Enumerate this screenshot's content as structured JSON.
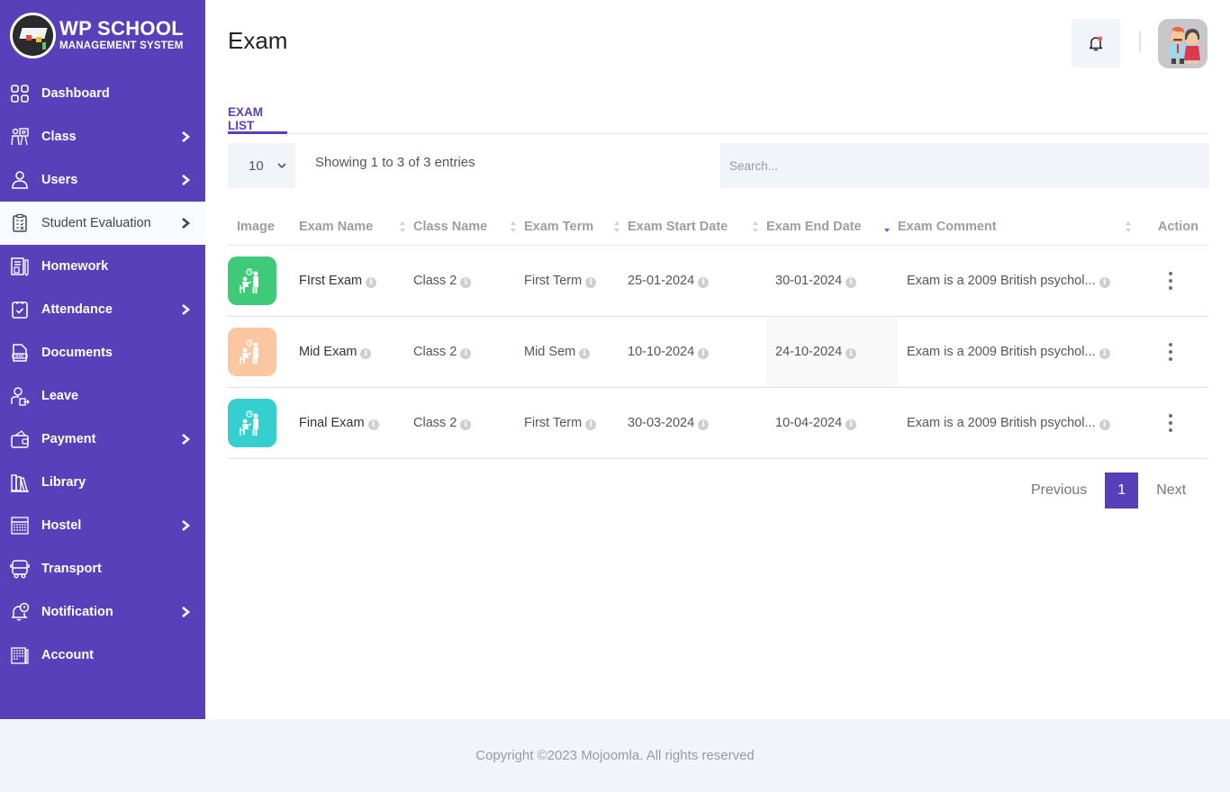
{
  "brand": {
    "title": "WP SCHOOL",
    "subtitle": "MANAGEMENT SYSTEM"
  },
  "colors": {
    "primary": "#5840bb",
    "active_bg": "#f8fbff",
    "panel_bg": "#f1f4f9",
    "notif_dot": "#f25c5c"
  },
  "sidebar": {
    "items": [
      {
        "label": "Dashboard",
        "icon": "dashboard-icon",
        "has_submenu": false,
        "active": false
      },
      {
        "label": "Class",
        "icon": "class-icon",
        "has_submenu": true,
        "active": false
      },
      {
        "label": "Users",
        "icon": "user-icon",
        "has_submenu": true,
        "active": false
      },
      {
        "label": "Student Evaluation",
        "icon": "clipboard-icon",
        "has_submenu": true,
        "active": true
      },
      {
        "label": "Homework",
        "icon": "homework-icon",
        "has_submenu": false,
        "active": false
      },
      {
        "label": "Attendance",
        "icon": "attendance-icon",
        "has_submenu": true,
        "active": false
      },
      {
        "label": "Documents",
        "icon": "document-icon",
        "has_submenu": false,
        "active": false
      },
      {
        "label": "Leave",
        "icon": "leave-icon",
        "has_submenu": false,
        "active": false
      },
      {
        "label": "Payment",
        "icon": "wallet-icon",
        "has_submenu": true,
        "active": false
      },
      {
        "label": "Library",
        "icon": "library-icon",
        "has_submenu": false,
        "active": false
      },
      {
        "label": "Hostel",
        "icon": "hostel-icon",
        "has_submenu": true,
        "active": false
      },
      {
        "label": "Transport",
        "icon": "bus-icon",
        "has_submenu": false,
        "active": false
      },
      {
        "label": "Notification",
        "icon": "notification-icon",
        "has_submenu": true,
        "active": false
      },
      {
        "label": "Account",
        "icon": "account-icon",
        "has_submenu": false,
        "active": false
      }
    ]
  },
  "header": {
    "title": "Exam"
  },
  "tabs": [
    {
      "label": "EXAM LIST",
      "active": true
    }
  ],
  "table_controls": {
    "page_length": "10",
    "info": "Showing 1 to 3 of 3 entries",
    "search_placeholder": "Search...",
    "search_value": ""
  },
  "table": {
    "columns": [
      "Image",
      "Exam Name",
      "Class Name",
      "Exam Term",
      "Exam Start Date",
      "Exam End Date",
      "Exam Comment",
      "Action"
    ],
    "sorted_column": "Exam End Date",
    "sort_direction": "desc",
    "rows": [
      {
        "image_color": "#3fca7a",
        "exam_name": "FIrst Exam",
        "class_name": "Class 2",
        "exam_term": "First Term",
        "start_date": "25-01-2024",
        "end_date": "30-01-2024",
        "comment": "Exam is a 2009 British psychol..."
      },
      {
        "image_color": "#fbc7a2",
        "exam_name": "Mid Exam",
        "class_name": "Class 2",
        "exam_term": "Mid Sem",
        "start_date": "10-10-2024",
        "end_date": "24-10-2024",
        "comment": "Exam is a 2009 British psychol..."
      },
      {
        "image_color": "#36cfcf",
        "exam_name": "Final Exam",
        "class_name": "Class 2",
        "exam_term": "First Term",
        "start_date": "30-03-2024",
        "end_date": "10-04-2024",
        "comment": "Exam is a 2009 British psychol..."
      }
    ]
  },
  "pagination": {
    "previous": "Previous",
    "current": "1",
    "next": "Next"
  },
  "footer": {
    "text": "Copyright ©2023 Mojoomla. All rights reserved"
  }
}
